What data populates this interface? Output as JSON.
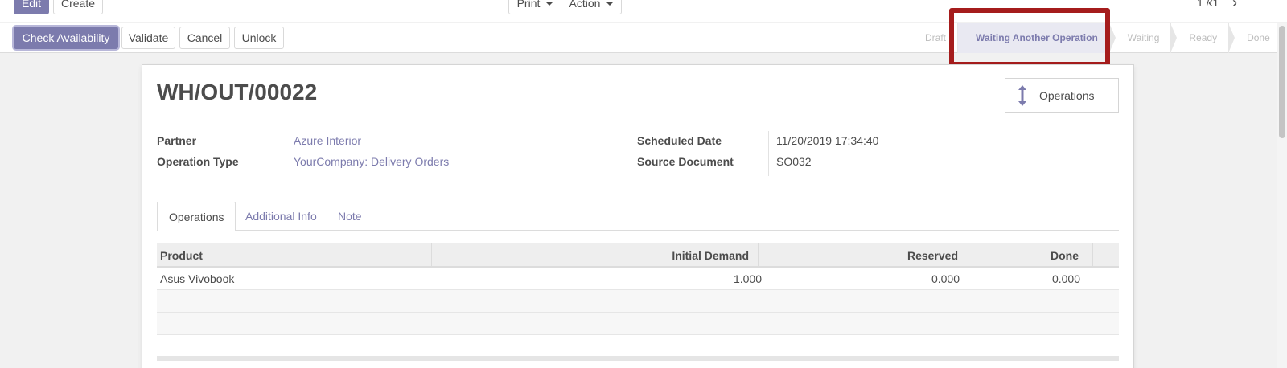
{
  "topbar": {
    "edit_label": "Edit",
    "create_label": "Create",
    "print_label": "Print",
    "action_label": "Action",
    "pager_text": "1 / 1",
    "prev_icon": "chevron-left-icon",
    "next_icon": "chevron-right-icon"
  },
  "actions": {
    "check_availability": "Check Availability",
    "validate": "Validate",
    "cancel": "Cancel",
    "unlock": "Unlock"
  },
  "status": {
    "stages": [
      "Draft",
      "Waiting Another Operation",
      "Waiting",
      "Ready",
      "Done"
    ],
    "current": "Waiting Another Operation"
  },
  "record": {
    "title": "WH/OUT/00022",
    "smart_button": {
      "label": "Operations",
      "icon": "vertical-arrows-icon"
    },
    "fields": {
      "partner_label": "Partner",
      "partner_value": "Azure Interior",
      "operation_type_label": "Operation Type",
      "operation_type_value": "YourCompany: Delivery Orders",
      "scheduled_date_label": "Scheduled Date",
      "scheduled_date_value": "11/20/2019 17:34:40",
      "source_document_label": "Source Document",
      "source_document_value": "SO032"
    }
  },
  "tabs": [
    "Operations",
    "Additional Info",
    "Note"
  ],
  "table": {
    "headers": [
      "Product",
      "Initial Demand",
      "Reserved",
      "Done"
    ],
    "rows": [
      [
        "Asus Vivobook",
        "1.000",
        "0.000",
        "0.000"
      ]
    ]
  },
  "colors": {
    "primary": "#7c7bad",
    "highlight_border": "#a51c1c"
  }
}
